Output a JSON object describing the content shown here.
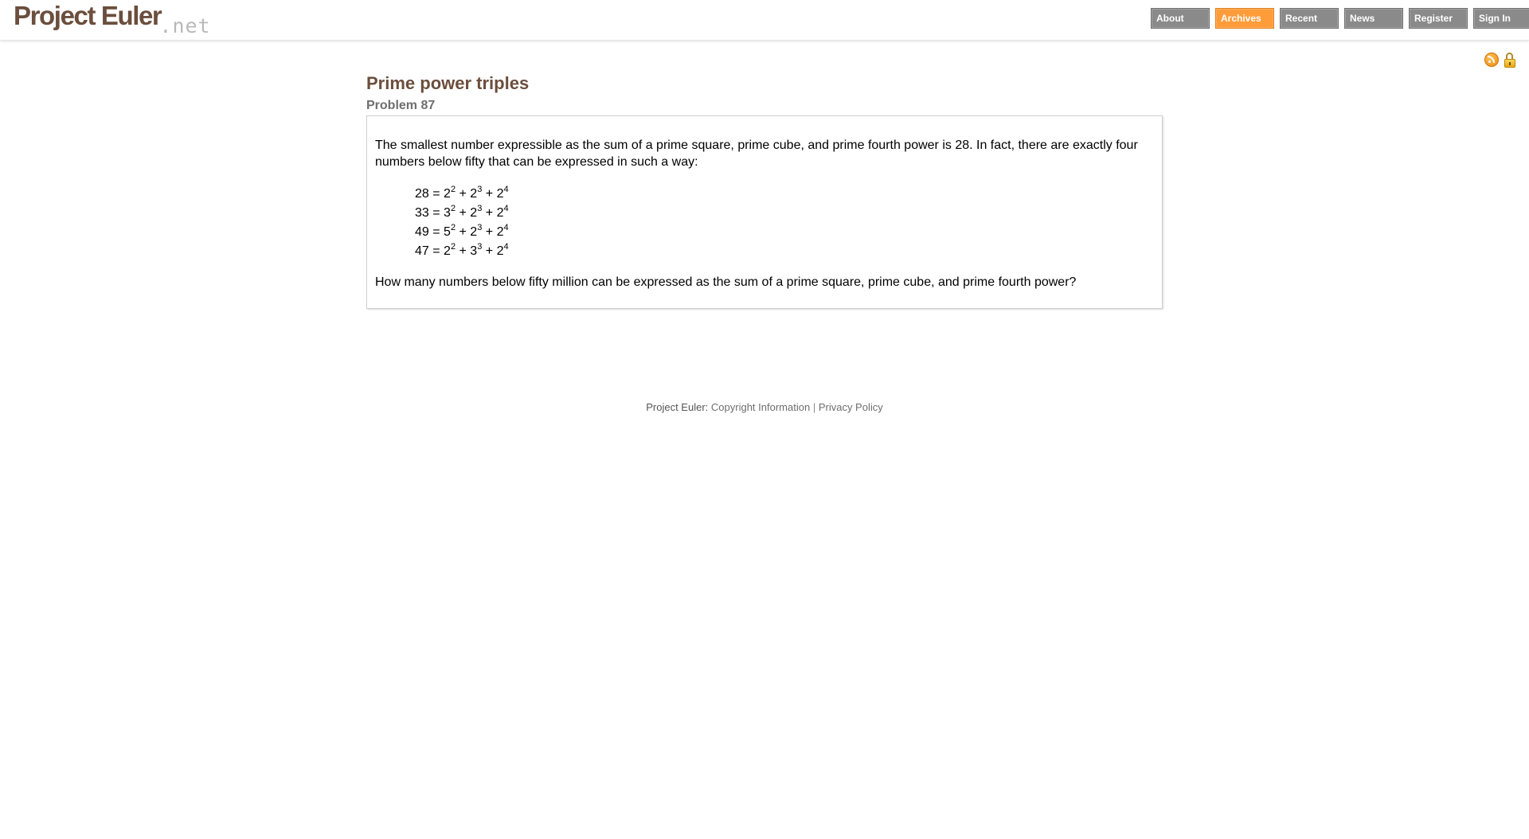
{
  "header": {
    "logo": {
      "main": "Project Euler",
      "tld": ".net"
    },
    "nav": [
      {
        "label": "About",
        "active": false
      },
      {
        "label": "Archives",
        "active": true
      },
      {
        "label": "Recent",
        "active": false
      },
      {
        "label": "News",
        "active": false
      },
      {
        "label": "Register",
        "active": false
      },
      {
        "label": "Sign In",
        "active": false
      }
    ],
    "icons": [
      "rss-icon",
      "lock-icon"
    ]
  },
  "problem": {
    "title": "Prime power triples",
    "info": "Problem 87",
    "intro": "The smallest number expressible as the sum of a prime square, prime cube, and prime fourth power is 28. In fact, there are exactly four numbers below fifty that can be expressed in such a way:",
    "equations": [
      {
        "n": "28",
        "a": "2",
        "b": "2",
        "c": "2"
      },
      {
        "n": "33",
        "a": "3",
        "b": "2",
        "c": "2"
      },
      {
        "n": "49",
        "a": "5",
        "b": "2",
        "c": "2"
      },
      {
        "n": "47",
        "a": "2",
        "b": "3",
        "c": "2"
      }
    ],
    "exponents": {
      "square": "2",
      "cube": "3",
      "fourth": "4"
    },
    "question": "How many numbers below fifty million can be expressed as the sum of a prime square, prime cube, and prime fourth power?"
  },
  "footer": {
    "prefix": "Project Euler:",
    "copyright": "Copyright Information",
    "separator": "|",
    "privacy": "Privacy Policy"
  },
  "colors": {
    "brand": "#6b4e3d",
    "nav_bg": "#8a8a8a",
    "nav_active": "#ff9c3a"
  }
}
